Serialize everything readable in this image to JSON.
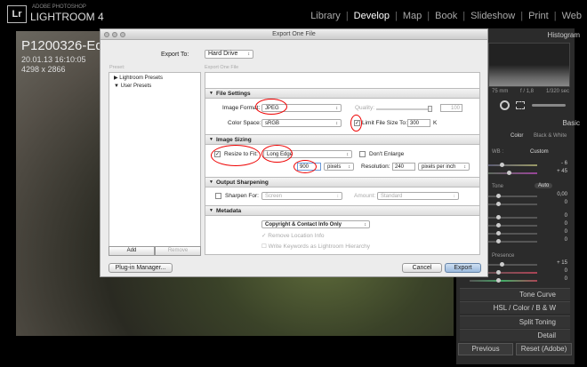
{
  "app": {
    "logo": "Lr",
    "brand_small": "ADOBE PHOTOSHOP",
    "brand": "LIGHTROOM 4"
  },
  "modules": [
    "Library",
    "Develop",
    "Map",
    "Book",
    "Slideshow",
    "Print",
    "Web"
  ],
  "active_module": "Develop",
  "photo": {
    "title": "P1200326-Ed",
    "date": "20.01.13 16:10:05",
    "size": "4298 x 2866"
  },
  "right_panel": {
    "histogram": "Histogram",
    "focal": "75 mm",
    "aperture": "f / 1,8",
    "shutter": "1/320 sec",
    "basic": "Basic",
    "color": "Color",
    "bw": "Black & White",
    "wb": "WB :",
    "wb_value": "Custom",
    "temp": "- 6",
    "tint": "+ 45",
    "tone": "Tone",
    "auto": "Auto",
    "exposure": "0,00",
    "contrast": "0",
    "highlights": "0",
    "shadows": "0",
    "whites": "0",
    "blacks": "0",
    "presence": "Presence",
    "clarity": "+ 15",
    "vibrance": "0",
    "saturation": "0",
    "tone_curve": "Tone Curve",
    "hsl": "HSL / Color / B & W",
    "split_toning": "Split Toning",
    "detail": "Detail",
    "previous": "Previous",
    "reset": "Reset (Adobe)"
  },
  "dialog": {
    "title": "Export One File",
    "export_to_label": "Export To:",
    "export_to": "Hard Drive",
    "preset_label": "Preset:",
    "presets": [
      "Lightroom Presets",
      "User Presets"
    ],
    "add": "Add",
    "remove": "Remove",
    "preset_name": "Export One File",
    "file_settings": {
      "header": "File Settings",
      "format_label": "Image Format:",
      "format": "JPEG",
      "quality_label": "Quality:",
      "quality": "100",
      "color_space_label": "Color Space:",
      "color_space": "sRGB",
      "limit_label": "Limit File Size To:",
      "limit_value": "300",
      "limit_unit": "K",
      "limit_checked": true
    },
    "image_sizing": {
      "header": "Image Sizing",
      "resize_label": "Resize to Fit:",
      "resize_checked": true,
      "resize_mode": "Long Edge",
      "dont_enlarge": "Don't Enlarge",
      "size": "900",
      "unit": "pixels",
      "resolution_label": "Resolution:",
      "resolution": "240",
      "res_unit": "pixels per inch"
    },
    "output_sharpening": {
      "header": "Output Sharpening",
      "sharpen_label": "Sharpen For:",
      "sharpen_for": "Screen",
      "amount_label": "Amount:",
      "amount": "Standard"
    },
    "metadata": {
      "header": "Metadata",
      "include": "Copyright & Contact Info Only",
      "remove_location": "Remove Location Info",
      "write_keywords": "Write Keywords as Lightroom Hierarchy"
    },
    "plugin_manager": "Plug-in Manager...",
    "cancel": "Cancel",
    "export": "Export"
  }
}
